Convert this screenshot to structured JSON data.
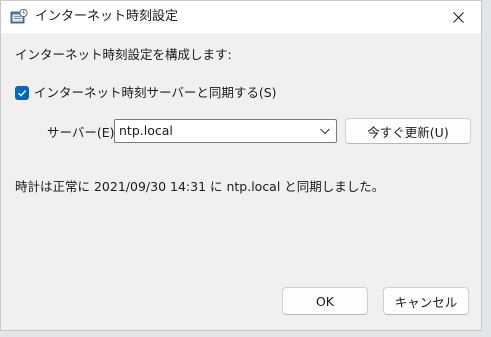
{
  "window": {
    "title": "インターネット時刻設定",
    "app_icon": "clock-settings-icon",
    "close_icon": "close-icon"
  },
  "content": {
    "instruction": "インターネット時刻設定を構成します:",
    "sync_checkbox": {
      "label": "インターネット時刻サーバーと同期する(S)",
      "checked": true
    },
    "server": {
      "label": "サーバー(E):",
      "value": "ntp.local",
      "dropdown_icon": "chevron-down-icon"
    },
    "update_button_label": "今すぐ更新(U)",
    "status": "時計は正常に 2021/09/30 14:31 に ntp.local と同期しました。"
  },
  "buttons": {
    "ok": "OK",
    "cancel": "キャンセル"
  },
  "colors": {
    "accent": "#0067c0",
    "dialog_bg": "#f0f0f0",
    "titlebar_bg": "#ffffff"
  }
}
